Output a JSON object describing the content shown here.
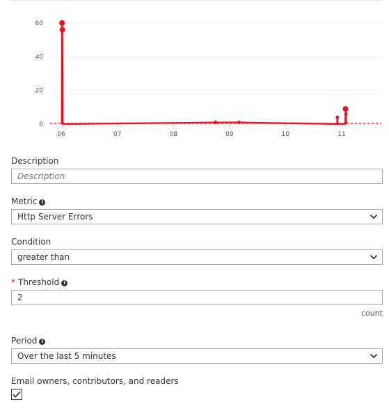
{
  "chart_data": {
    "type": "line",
    "x_ticks": [
      "06",
      "07",
      "08",
      "09",
      "10",
      "11"
    ],
    "y_ticks": [
      "60",
      "40",
      "20",
      "0"
    ],
    "ylim": [
      0,
      60
    ],
    "series_color": "#e81123",
    "x": [
      "06 00:10",
      "06 00:20",
      "06 00:30",
      "06 00:40",
      "06 00:50",
      "08 18:00",
      "09 04:00",
      "10 22:00",
      "10 22:10",
      "10 22:20",
      "11 01:00",
      "11 01:30",
      "11 01:40",
      "11 01:50",
      "11 02:00"
    ],
    "values": [
      0,
      60,
      56,
      0,
      0,
      1,
      1,
      0,
      4,
      0,
      0,
      0,
      9,
      6,
      0
    ]
  },
  "form": {
    "description_label": "Description",
    "description_placeholder": "Description",
    "description_value": "",
    "metric_label": "Metric",
    "metric_value": "Http Server Errors",
    "condition_label": "Condition",
    "condition_value": "greater than",
    "threshold_required_mark": "*",
    "threshold_label": "Threshold",
    "threshold_value": "2",
    "threshold_unit": "count",
    "period_label": "Period",
    "period_value": "Over the last 5 minutes",
    "email_label": "Email owners, contributors, and readers",
    "email_checked": true
  },
  "icons": {
    "info": "info-icon",
    "dropdown": "chevron-down-icon",
    "check": "checkmark-icon"
  },
  "colors": {
    "series": "#e81123",
    "required": "#e81123",
    "border": "#a6a6a6"
  }
}
